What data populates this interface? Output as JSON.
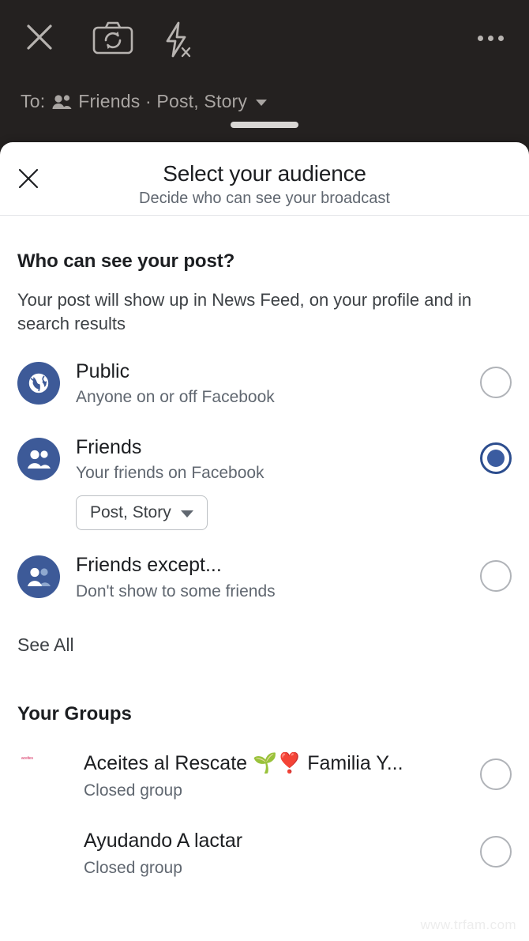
{
  "camera": {
    "icons": {
      "close": "close-icon",
      "flip": "camera-flip-icon",
      "flash_off": "flash-off-icon",
      "more": "more-options-icon"
    },
    "audience_prefix": "To:",
    "audience_value": "Friends · Post, Story"
  },
  "sheet": {
    "title": "Select your audience",
    "subtitle": "Decide who can see your broadcast",
    "close_label": "×"
  },
  "post_visibility": {
    "heading": "Who can see your post?",
    "description": "Your post will show up in News Feed, on your profile and in search results",
    "options": [
      {
        "label": "Public",
        "sub": "Anyone on or off Facebook",
        "icon": "globe-icon",
        "selected": false
      },
      {
        "label": "Friends",
        "sub": "Your friends on Facebook",
        "icon": "friends-icon",
        "selected": true,
        "pill": "Post, Story"
      },
      {
        "label": "Friends except...",
        "sub": "Don't show to some friends",
        "icon": "friends-except-icon",
        "selected": false
      }
    ],
    "see_all": "See All"
  },
  "groups": {
    "heading": "Your Groups",
    "items": [
      {
        "name": "Aceites al Rescate 🌱❣️ Familia Y...",
        "sub": "Closed group",
        "avatar": "oil-bottles-thumbnail",
        "selected": false
      },
      {
        "name": "Ayudando A lactar",
        "sub": "Closed group",
        "avatar": "woman-photo-thumbnail",
        "selected": false
      }
    ]
  },
  "watermark": "www.trfam.com",
  "colors": {
    "brand_blue": "#3d5a98",
    "radio_selected": "#3b5ca0",
    "camera_bg": "#242120",
    "text_primary": "#1c1e21",
    "text_secondary": "#606770"
  }
}
